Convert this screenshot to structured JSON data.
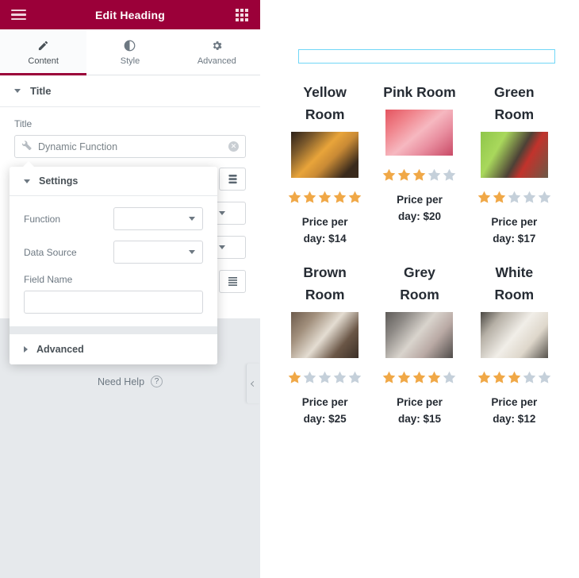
{
  "panel": {
    "header": {
      "title": "Edit Heading",
      "menu_icon": "hamburger-menu-icon",
      "grid_icon": "widgets-grid-icon"
    },
    "tabs": [
      {
        "label": "Content",
        "icon": "pencil-icon",
        "active": true
      },
      {
        "label": "Style",
        "icon": "contrast-half-circle-icon",
        "active": false
      },
      {
        "label": "Advanced",
        "icon": "gear-icon",
        "active": false
      }
    ],
    "title_section": {
      "heading": "Title",
      "field_label": "Title",
      "field_value": "Dynamic Function",
      "field_icon": "wrench-icon",
      "clear_icon": "clear-circle-x-icon"
    },
    "popup": {
      "heading": "Settings",
      "fields": [
        {
          "label": "Function",
          "type": "select",
          "value": ""
        },
        {
          "label": "Data Source",
          "type": "select",
          "value": ""
        },
        {
          "label": "Field Name",
          "type": "text",
          "value": ""
        }
      ],
      "footer_heading": "Advanced"
    },
    "need_help": {
      "label": "Need Help",
      "icon": "question-mark-icon"
    },
    "collapse_icon": "chevron-left-icon",
    "accent_color": "#9b0039",
    "background_color": "#e6e9ec"
  },
  "preview": {
    "heading_widget": {
      "value": "",
      "selected": true,
      "outline_color": "#71d7f7"
    },
    "rooms": [
      {
        "name": "Yellow Room",
        "rating": 5,
        "max_rating": 5,
        "price_text": "Price per day: $14",
        "price": 14,
        "image": "yellow-room-photo"
      },
      {
        "name": "Pink Room",
        "rating": 3,
        "max_rating": 5,
        "price_text": "Price per day: $20",
        "price": 20,
        "image": "pink-room-photo"
      },
      {
        "name": "Green Room",
        "rating": 2,
        "max_rating": 5,
        "price_text": "Price per day: $17",
        "price": 17,
        "image": "green-room-photo"
      },
      {
        "name": "Brown Room",
        "rating": 1,
        "max_rating": 5,
        "price_text": "Price per day: $25",
        "price": 25,
        "image": "brown-room-photo"
      },
      {
        "name": "Grey Room",
        "rating": 4,
        "max_rating": 5,
        "price_text": "Price per day: $15",
        "price": 15,
        "image": "grey-room-photo"
      },
      {
        "name": "White Room",
        "rating": 3,
        "max_rating": 5,
        "price_text": "Price per day: $12",
        "price": 12,
        "image": "white-room-photo"
      }
    ],
    "star_filled_color": "#f0a847",
    "star_empty_color": "#c5d0da"
  }
}
